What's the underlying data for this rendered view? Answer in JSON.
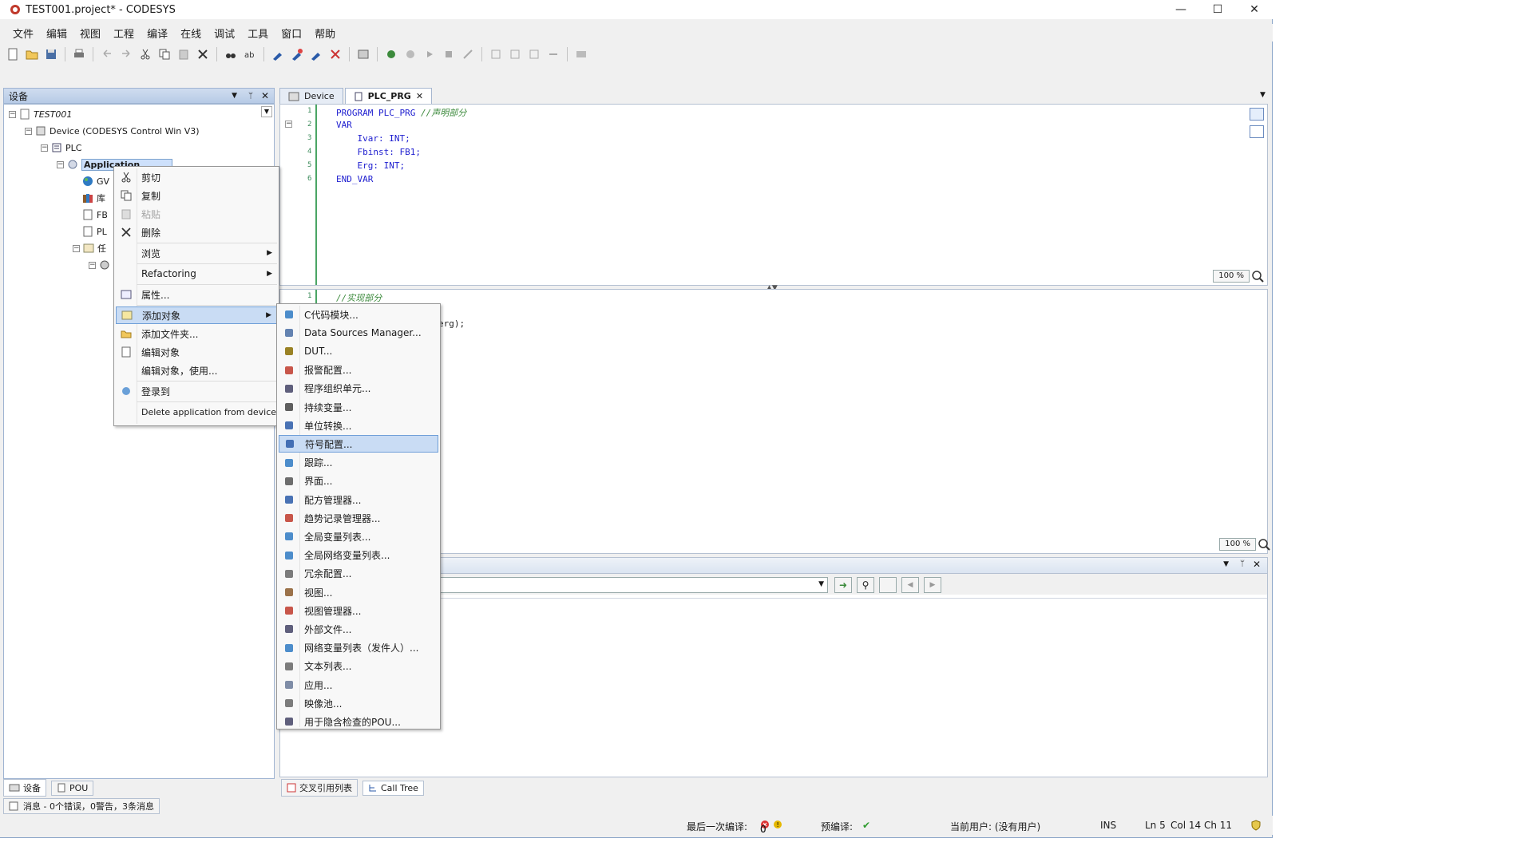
{
  "window": {
    "title": "TEST001.project* - CODESYS",
    "controls": [
      "—",
      "☐",
      "✕"
    ]
  },
  "menu": [
    "文件",
    "编辑",
    "视图",
    "工程",
    "编译",
    "在线",
    "调试",
    "工具",
    "窗口",
    "帮助"
  ],
  "left_panel": {
    "title": "设备",
    "tree": {
      "root": "TEST001",
      "device": "Device (CODESYS Control Win V3)",
      "plc": "PLC",
      "application": "Application",
      "child_gvl": "GV",
      "child_lib": "库",
      "child_fb": "FB",
      "child_plc": "PL",
      "child_task": "任"
    },
    "bottom_tabs": [
      "设备",
      "POU"
    ]
  },
  "editor": {
    "tabs": [
      "Device",
      "PLC_PRG"
    ],
    "decl_lines": [
      {
        "n": "1",
        "text": "PROGRAM PLC_PRG ",
        "comment": "//声明部分"
      },
      {
        "n": "2",
        "text": "VAR",
        "comment": ""
      },
      {
        "n": "3",
        "text": "    Ivar: INT;",
        "comment": ""
      },
      {
        "n": "4",
        "text": "    Fbinst: FB1;",
        "comment": ""
      },
      {
        "n": "5",
        "text": "    Erg: INT;",
        "comment": ""
      },
      {
        "n": "6",
        "text": "END_VAR",
        "comment": ""
      }
    ],
    "impl_lines": [
      {
        "n": "1",
        "text": "",
        "comment": "//实现部分"
      },
      {
        "n": "",
        "text": "erg);",
        "comment": ""
      }
    ],
    "zoom_top": "100 %",
    "zoom_bottom": "100 %"
  },
  "output_tabs": [
    "交叉引用列表",
    "Call Tree"
  ],
  "message_bar": "消息 - 0个错误，0警告，3条消息",
  "status": {
    "last_compile_label": "最后一次编译:",
    "errors": "0",
    "warnings": "0",
    "precompile_label": "预编译:",
    "user": "当前用户: (没有用户)",
    "ins": "INS",
    "ln": "Ln 5",
    "col": "Col 14",
    "ch": "Ch 11"
  },
  "context_menu": {
    "items": [
      {
        "label": "剪切",
        "icon": "scissors-icon",
        "disabled": false
      },
      {
        "label": "复制",
        "icon": "copy-icon",
        "disabled": false
      },
      {
        "label": "粘贴",
        "icon": "paste-icon",
        "disabled": true
      },
      {
        "label": "删除",
        "icon": "delete-icon",
        "disabled": false
      },
      {
        "label": "浏览",
        "icon": "",
        "submenu": true
      },
      {
        "label": "Refactoring",
        "icon": "",
        "submenu": true
      },
      {
        "label": "属性...",
        "icon": "properties-icon"
      },
      {
        "label": "添加对象",
        "icon": "add-object-icon",
        "submenu": true,
        "highlighted": true
      },
      {
        "label": "添加文件夹...",
        "icon": "folder-icon"
      },
      {
        "label": "编辑对象",
        "icon": "edit-object-icon"
      },
      {
        "label": "编辑对象，使用...",
        "icon": ""
      },
      {
        "label": "登录到",
        "icon": "login-icon"
      },
      {
        "label": "Delete application from device",
        "icon": ""
      }
    ]
  },
  "submenu": {
    "items": [
      {
        "label": "C代码模块...",
        "icon": "c-module-icon"
      },
      {
        "label": "Data Sources Manager...",
        "icon": "data-sources-icon"
      },
      {
        "label": "DUT...",
        "icon": "dut-icon"
      },
      {
        "label": "报警配置...",
        "icon": "alarm-icon"
      },
      {
        "label": "程序组织单元...",
        "icon": "pou-icon"
      },
      {
        "label": "持续变量...",
        "icon": "persistent-icon"
      },
      {
        "label": "单位转换...",
        "icon": "unit-conversion-icon"
      },
      {
        "label": "符号配置...",
        "icon": "symbol-config-icon",
        "highlighted": true
      },
      {
        "label": "跟踪...",
        "icon": "trace-icon"
      },
      {
        "label": "界面...",
        "icon": "interface-icon"
      },
      {
        "label": "配方管理器...",
        "icon": "recipe-icon"
      },
      {
        "label": "趋势记录管理器...",
        "icon": "trend-icon"
      },
      {
        "label": "全局变量列表...",
        "icon": "gvl-icon"
      },
      {
        "label": "全局网络变量列表...",
        "icon": "network-gvl-icon"
      },
      {
        "label": "冗余配置...",
        "icon": "redundancy-icon"
      },
      {
        "label": "视图...",
        "icon": "visu-icon"
      },
      {
        "label": "视图管理器...",
        "icon": "visu-manager-icon"
      },
      {
        "label": "外部文件...",
        "icon": "external-file-icon"
      },
      {
        "label": "网络变量列表（发件人）...",
        "icon": "network-sender-icon"
      },
      {
        "label": "文本列表...",
        "icon": "text-list-icon"
      },
      {
        "label": "应用...",
        "icon": "application-icon"
      },
      {
        "label": "映像池...",
        "icon": "image-pool-icon"
      },
      {
        "label": "用于隐含检查的POU...",
        "icon": "implicit-check-icon"
      }
    ]
  },
  "colors": {
    "highlight": "#c9dcf4",
    "gutter_green": "#4aa564",
    "keyword": "#1d1dcf",
    "comment": "#3c8a3c"
  }
}
